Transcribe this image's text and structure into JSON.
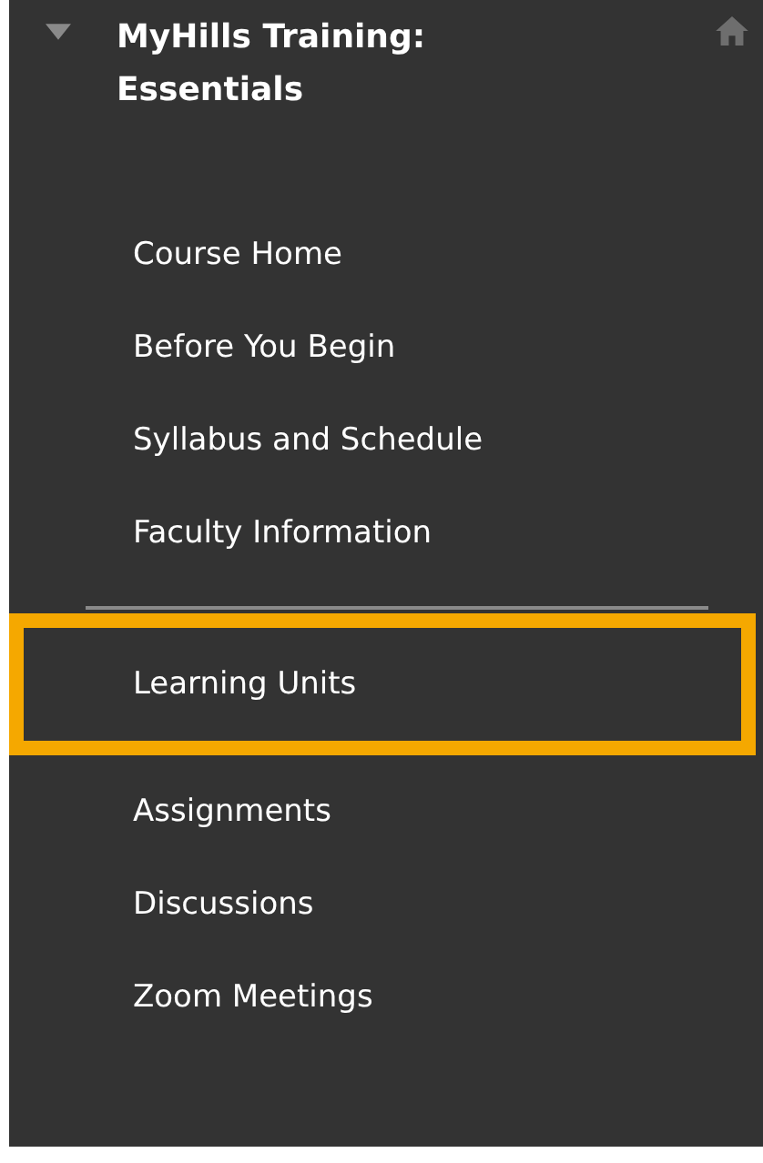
{
  "course": {
    "title": "MyHills Training: Essentials",
    "expanded": true
  },
  "groups": [
    {
      "items": [
        {
          "label": "Course Home",
          "highlighted": false
        },
        {
          "label": "Before You Begin",
          "highlighted": false
        },
        {
          "label": "Syllabus and Schedule",
          "highlighted": false
        },
        {
          "label": "Faculty Information",
          "highlighted": false
        }
      ]
    },
    {
      "items": [
        {
          "label": "Learning Units",
          "highlighted": true
        },
        {
          "label": "Assignments",
          "highlighted": false
        },
        {
          "label": "Discussions",
          "highlighted": false
        },
        {
          "label": "Zoom Meetings",
          "highlighted": false
        }
      ]
    }
  ]
}
